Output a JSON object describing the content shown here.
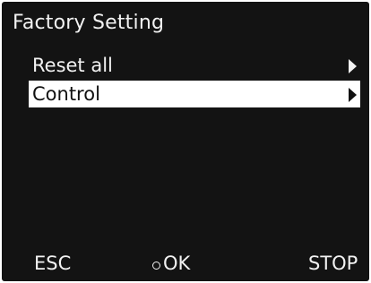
{
  "screen": {
    "title": "Factory Setting"
  },
  "menu": {
    "items": [
      {
        "label": "Reset all",
        "selected": false,
        "icon": "arrow-right-icon"
      },
      {
        "label": "Control",
        "selected": true,
        "icon": "arrow-right-icon"
      }
    ]
  },
  "softkeys": {
    "esc_label": "ESC",
    "ok_label": "OK",
    "ok_icon": "ok-circle-icon",
    "stop_label": "STOP"
  },
  "colors": {
    "background": "#131313",
    "text": "#f2f2f2",
    "highlight": "#ffffff",
    "highlight_text": "#111111"
  }
}
